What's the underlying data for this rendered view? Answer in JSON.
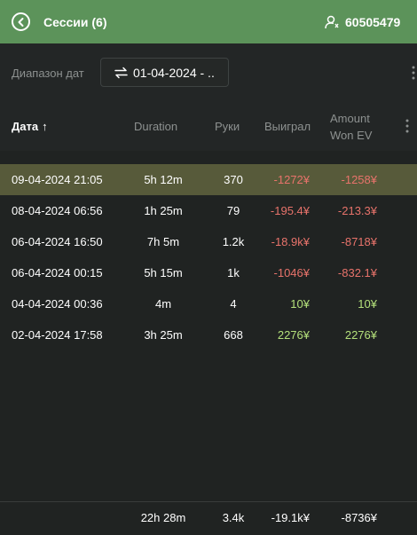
{
  "header": {
    "title": "Сессии (6)",
    "user_id": "60505479"
  },
  "filter": {
    "label": "Диапазон дат",
    "range_value": "01-04-2024 - .."
  },
  "table": {
    "columns": {
      "date": "Дата",
      "date_sort": "↑",
      "duration": "Duration",
      "hands": "Руки",
      "won": "Выиграл",
      "amount_ev_line1": "Amount",
      "amount_ev_line2": "Won EV"
    },
    "rows": [
      {
        "date": "09-04-2024 21:05",
        "duration": "5h 12m",
        "hands": "370",
        "won": "-1272¥",
        "ev": "-1258¥",
        "selected": true
      },
      {
        "date": "08-04-2024 06:56",
        "duration": "1h 25m",
        "hands": "79",
        "won": "-195.4¥",
        "ev": "-213.3¥"
      },
      {
        "date": "06-04-2024 16:50",
        "duration": "7h 5m",
        "hands": "1.2k",
        "won": "-18.9k¥",
        "ev": "-8718¥"
      },
      {
        "date": "06-04-2024 00:15",
        "duration": "5h 15m",
        "hands": "1k",
        "won": "-1046¥",
        "ev": "-832.1¥"
      },
      {
        "date": "04-04-2024 00:36",
        "duration": "4m",
        "hands": "4",
        "won": "10¥",
        "ev": "10¥"
      },
      {
        "date": "02-04-2024 17:58",
        "duration": "3h 25m",
        "hands": "668",
        "won": "2276¥",
        "ev": "2276¥"
      }
    ],
    "totals": {
      "duration": "22h 28m",
      "hands": "3.4k",
      "won": "-19.1k¥",
      "ev": "-8736¥"
    }
  },
  "colors": {
    "header_bg": "#5c935a",
    "negative": "#e8736b",
    "positive": "#b4e07b",
    "selected_row": "#575a3a"
  }
}
